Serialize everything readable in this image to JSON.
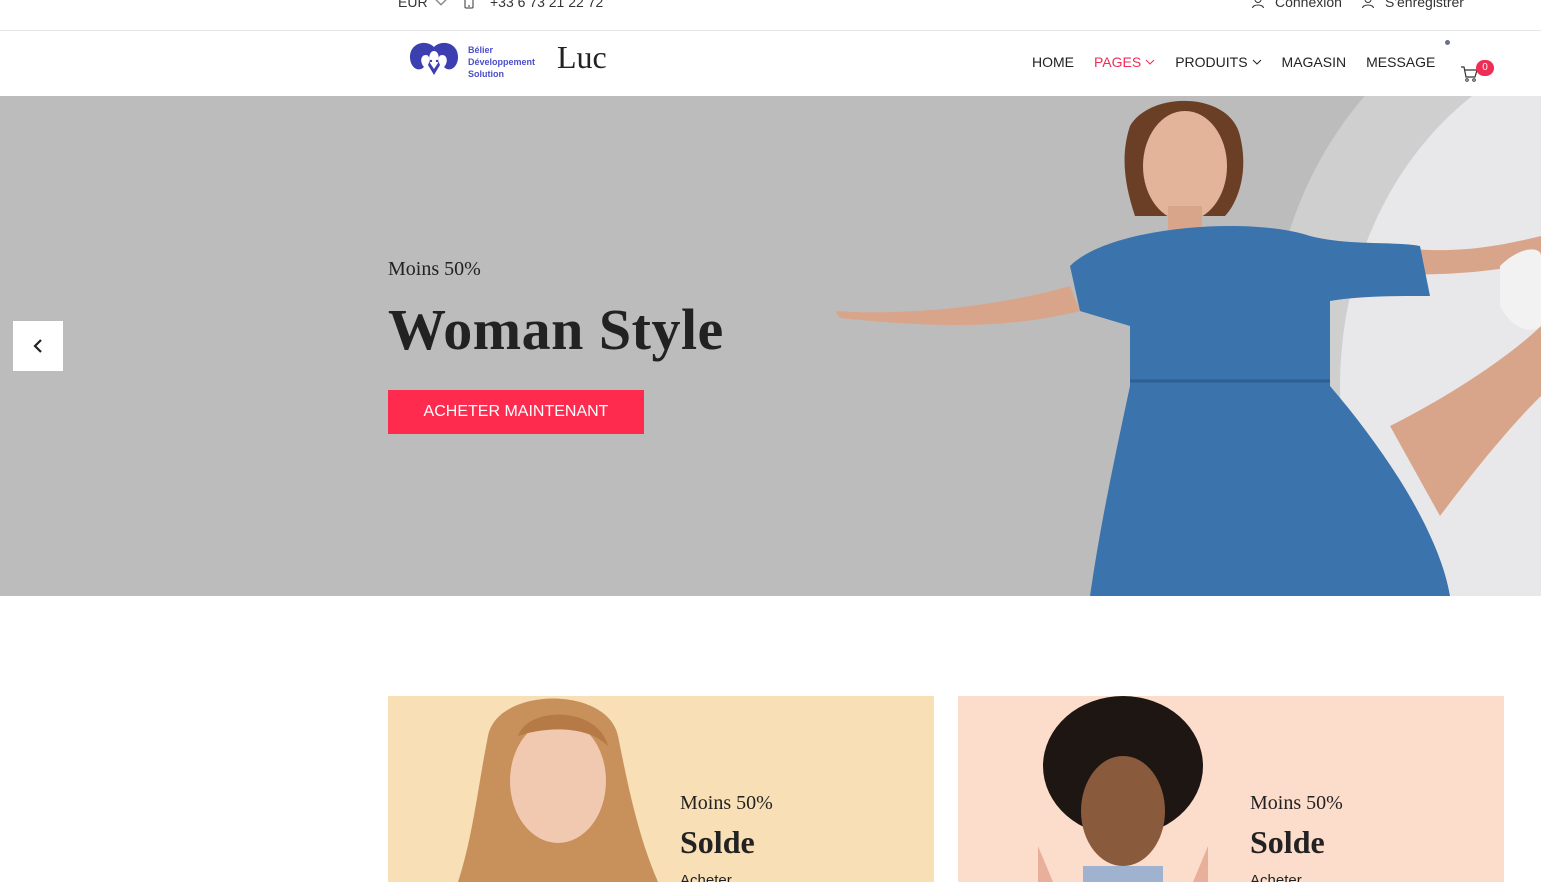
{
  "topbar": {
    "currency": "EUR",
    "phone": "+33 6 73 21 22 72",
    "login": "Connexion",
    "register": "S'enregistrer"
  },
  "header": {
    "logo_line1": "Bélier",
    "logo_line2": "Développement",
    "logo_line3": "Solution",
    "brand": "Luc",
    "nav": {
      "home": "HOME",
      "pages": "PAGES",
      "products": "PRODUITS",
      "store": "MAGASIN",
      "message": "MESSAGE"
    },
    "cart_count": "0"
  },
  "hero": {
    "subtitle": "Moins 50%",
    "title": "Woman Style",
    "cta": "ACHETER MAINTENANT"
  },
  "banners": [
    {
      "subtitle": "Moins 50%",
      "title": "Solde",
      "link": "Acheter"
    },
    {
      "subtitle": "Moins 50%",
      "title": "Solde",
      "link": "Acheter"
    }
  ],
  "colors": {
    "accent": "#ff2b4f",
    "hero_bg": "#bcbcbc",
    "banner1_bg": "#f8dfb5",
    "banner2_bg": "#fcdcca"
  }
}
